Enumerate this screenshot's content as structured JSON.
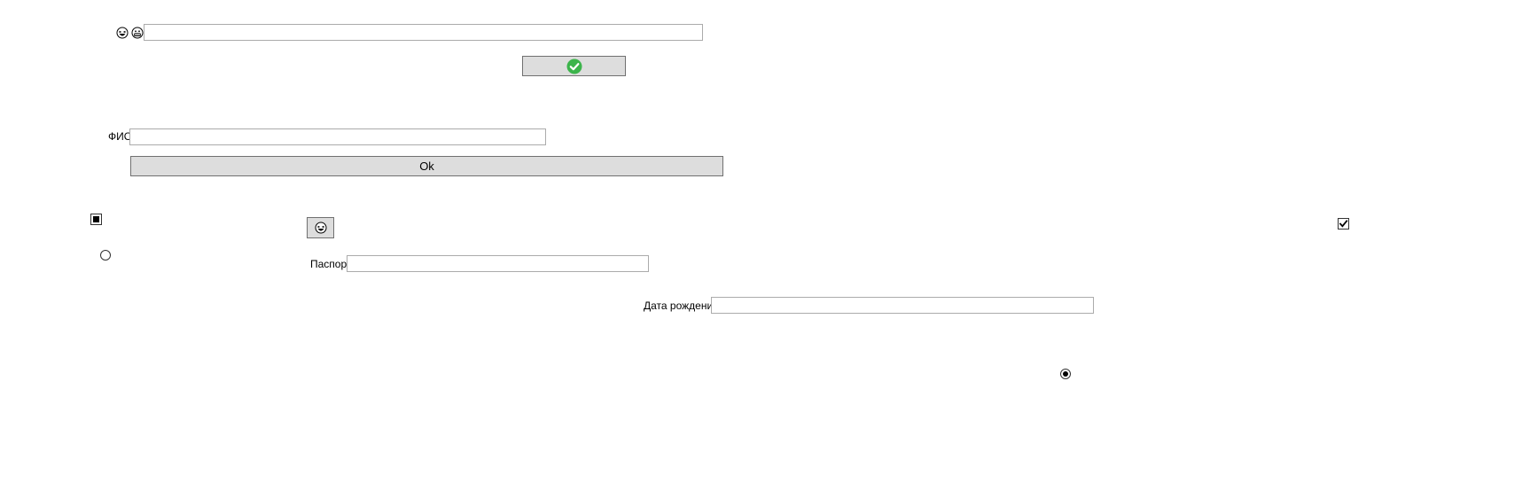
{
  "top_row": {
    "icons": [
      "laughing-face-icon",
      "grinning-face-icon"
    ],
    "input_value": ""
  },
  "confirm_button": {
    "icon": "check-circle-icon",
    "color": "#3cb44b"
  },
  "fio": {
    "label": "ФИО",
    "value": ""
  },
  "ok_button": {
    "label": "Ok"
  },
  "checkbox_indeterminate": {
    "state": "indeterminate"
  },
  "radio_left": {
    "checked": false
  },
  "emoji_button": {
    "icon": "laughing-face-icon"
  },
  "passport": {
    "label": "Паспорт",
    "value": ""
  },
  "checkbox_right": {
    "state": "checked"
  },
  "birth_date": {
    "label": "Дата рождения",
    "value": ""
  },
  "radio_right": {
    "checked": true
  }
}
